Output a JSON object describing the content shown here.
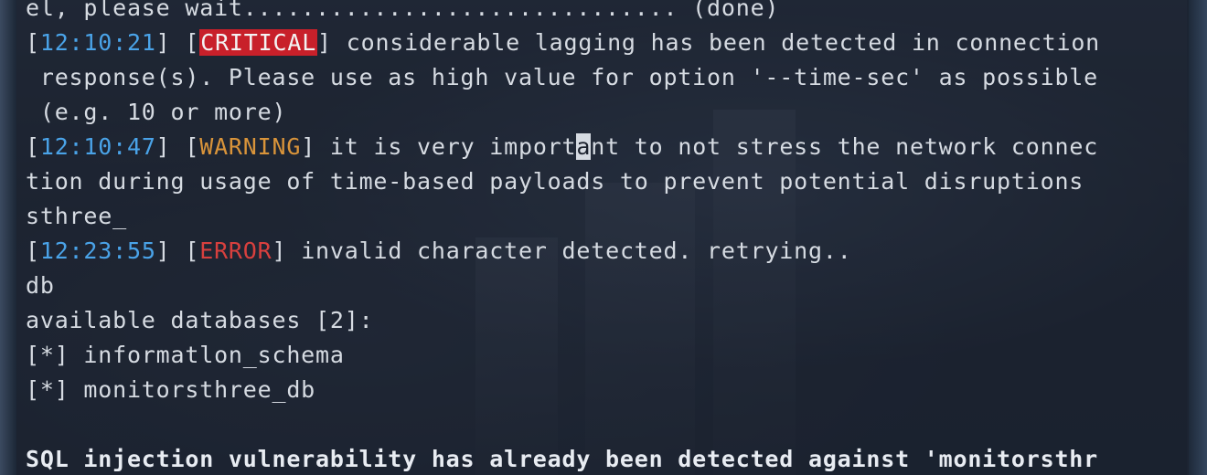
{
  "terminal": {
    "line0": "el, please wait.............................. (done)",
    "log1": {
      "timestamp": "12:10:21",
      "level": "CRITICAL",
      "msg": " considerable lagging has been detected in connection",
      "cont1": " response(s). Please use as high value for option '--time-sec' as possible",
      "cont2": " (e.g. 10 or more)"
    },
    "log2": {
      "timestamp": "12:10:47",
      "level": "WARNING",
      "msg_before_cursor": " it is very import",
      "cursor_char": "a",
      "msg_after_cursor": "nt to not stress the network connec",
      "cont1": "tion during usage of time-based payloads to prevent potential disruptions"
    },
    "line_sthree": "sthree_",
    "log3": {
      "timestamp": "12:23:55",
      "level": "ERROR",
      "msg": " invalid character detected. retrying.."
    },
    "line_db": "db",
    "available_header": "available databases [2]:",
    "databases": [
      "[*] informatlon_schema",
      "[*] monitorsthree_db"
    ],
    "final_message": "SQL injection vulnerability has already been detected against 'monitorsthr"
  },
  "colors": {
    "timestamp": "#4aa3e8",
    "critical_bg": "#c8202a",
    "warning": "#d9943a",
    "error": "#d8403e",
    "text": "#d6dbe2"
  }
}
